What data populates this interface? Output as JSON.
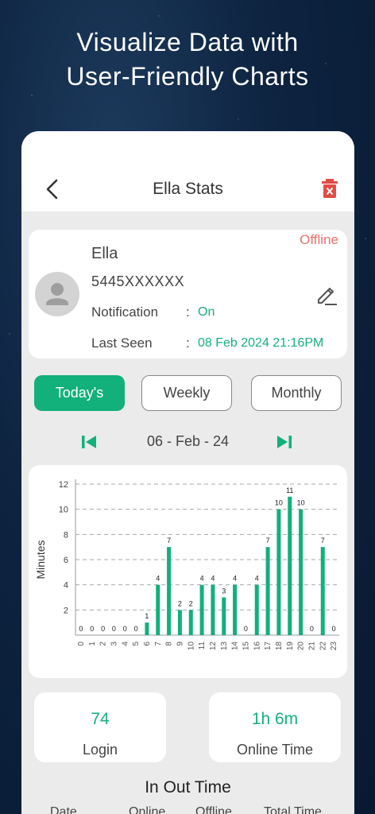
{
  "headline": {
    "line1": "Visualize Data with",
    "line2": "User-Friendly Charts"
  },
  "topbar": {
    "title": "Ella Stats"
  },
  "profile": {
    "name": "Ella",
    "phone": "5445XXXXXX",
    "status": "Offline",
    "notification_label": "Notification",
    "notification_value": "On",
    "last_seen_label": "Last Seen",
    "last_seen_value": "08 Feb 2024 21:16PM",
    "colon": ":"
  },
  "tabs": [
    {
      "label": "Today's",
      "active": true
    },
    {
      "label": "Weekly",
      "active": false
    },
    {
      "label": "Monthly",
      "active": false
    }
  ],
  "date_nav": {
    "label": "06  - Feb - 24"
  },
  "colors": {
    "accent": "#12b07a",
    "offline": "#e8716b"
  },
  "chart_data": {
    "type": "bar",
    "ylabel": "Minutes",
    "xlabel": "",
    "ylim": [
      0,
      12
    ],
    "yticks": [
      2,
      4,
      6,
      8,
      10,
      12
    ],
    "categories": [
      "0",
      "1",
      "2",
      "3",
      "4",
      "5",
      "6",
      "7",
      "8",
      "9",
      "10",
      "11",
      "12",
      "13",
      "14",
      "15",
      "16",
      "17",
      "18",
      "19",
      "20",
      "21",
      "22",
      "23"
    ],
    "values": [
      0,
      0,
      0,
      0,
      0,
      0,
      1,
      4,
      7,
      2,
      2,
      4,
      4,
      3,
      4,
      0,
      4,
      7,
      10,
      11,
      10,
      0,
      7,
      0
    ],
    "grid": true
  },
  "stats": [
    {
      "value": "74",
      "label": "Login"
    },
    {
      "value": "1h 6m",
      "label": "Online Time"
    }
  ],
  "inout": {
    "title": "In Out Time",
    "columns": [
      "Date",
      "Online",
      "Offline",
      "Total Time"
    ]
  }
}
